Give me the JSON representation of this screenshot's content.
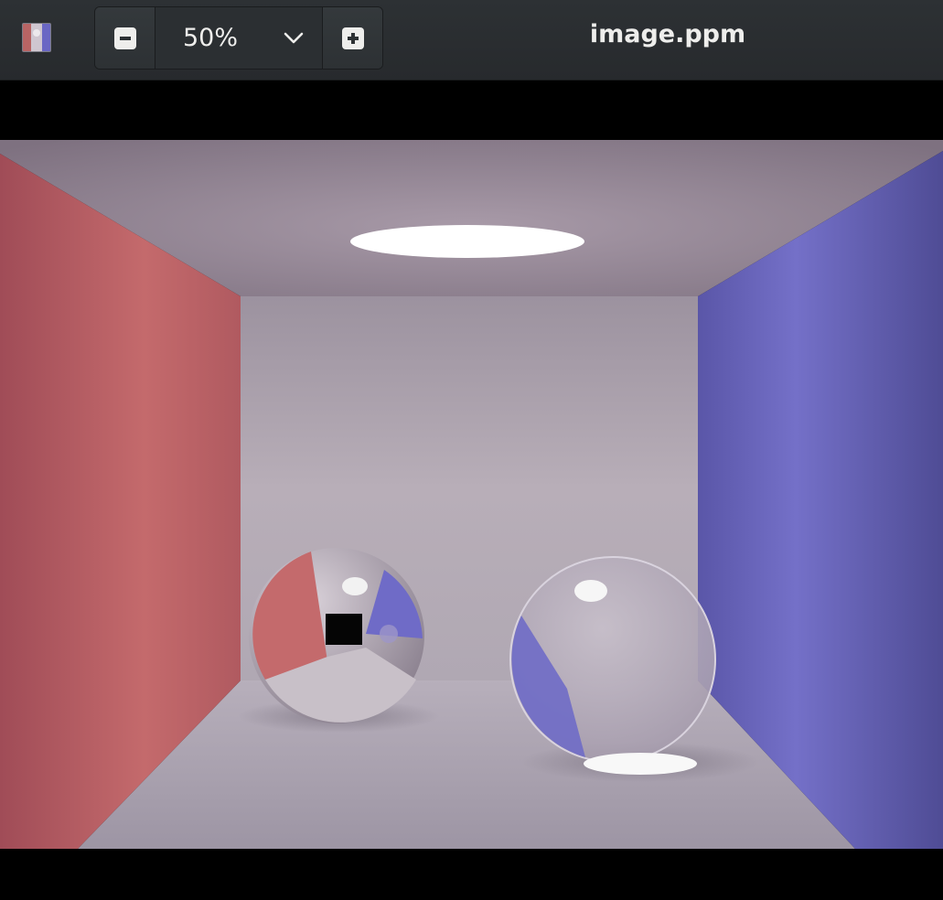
{
  "window": {
    "title": "image.ppm"
  },
  "toolbar": {
    "app_icon": "image-viewer-app-icon",
    "zoom_out_icon": "zoom-out-icon",
    "zoom_in_icon": "zoom-in-icon",
    "zoom_dropdown_icon": "chevron-down-icon",
    "zoom_value": "50%"
  },
  "image": {
    "scene": "cornell-box-render",
    "colors": {
      "left_wall": "#c46a6c",
      "right_wall": "#6f6bc7",
      "back_wall": "#b4aab4",
      "floor": "#b7afbb",
      "light": "#ffffff"
    }
  }
}
